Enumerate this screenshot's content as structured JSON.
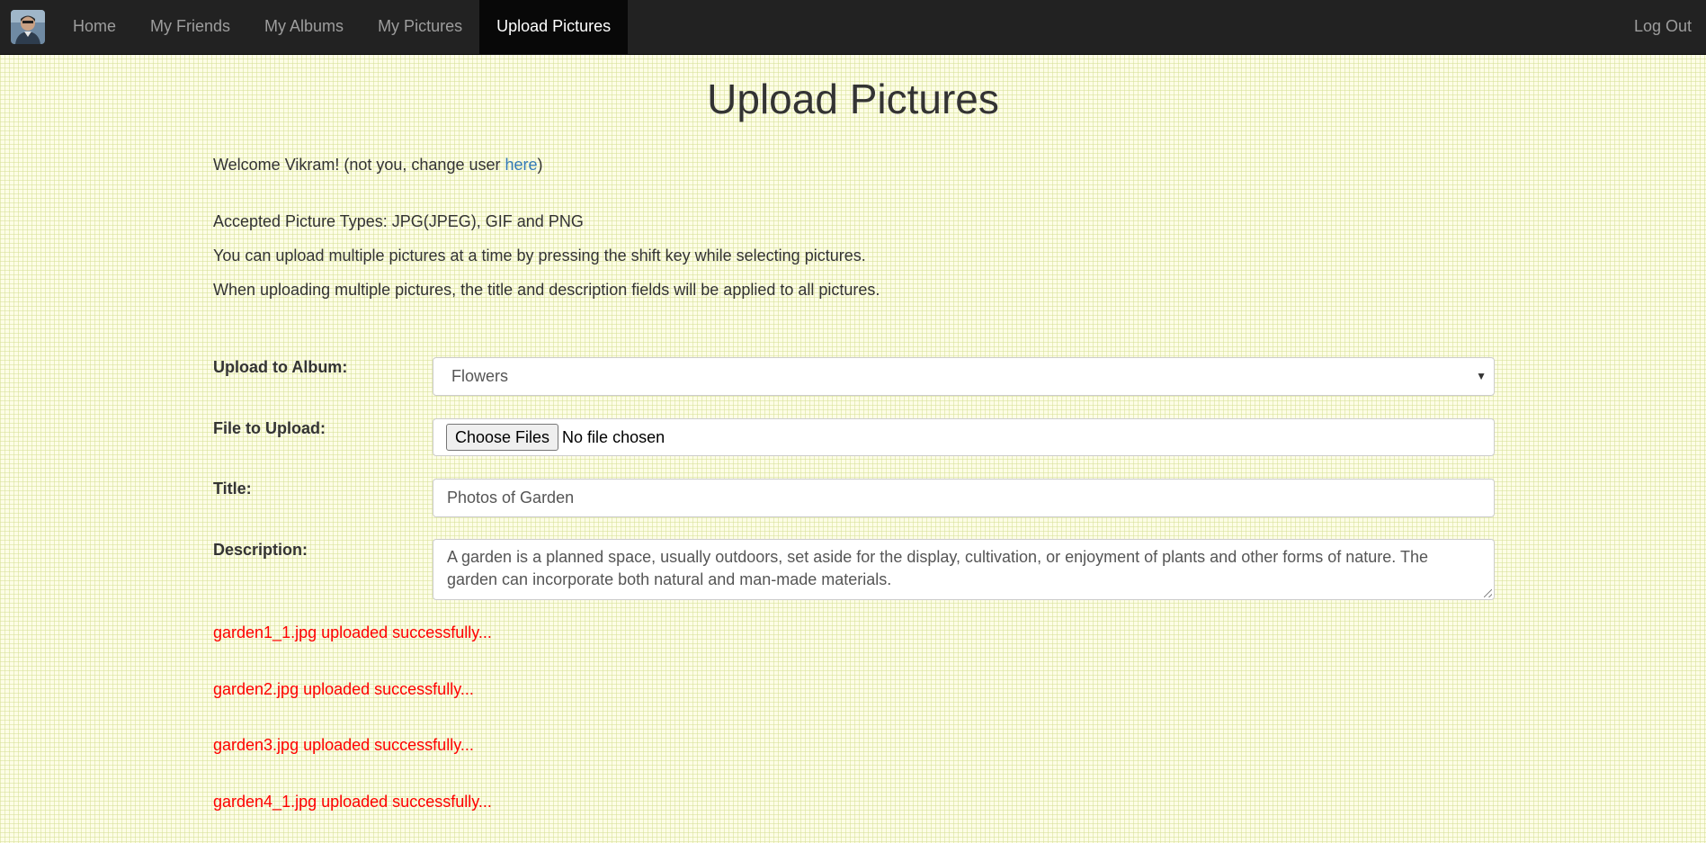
{
  "nav": {
    "items": [
      {
        "label": "Home",
        "active": false
      },
      {
        "label": "My Friends",
        "active": false
      },
      {
        "label": "My Albums",
        "active": false
      },
      {
        "label": "My Pictures",
        "active": false
      },
      {
        "label": "Upload Pictures",
        "active": true
      }
    ],
    "logout_label": "Log Out"
  },
  "page": {
    "title": "Upload Pictures"
  },
  "welcome": {
    "prefix": "Welcome Vikram! (not you, change user ",
    "link_label": "here",
    "suffix": ")"
  },
  "info": {
    "line1": "Accepted Picture Types: JPG(JPEG), GIF and PNG",
    "line2": "You can upload multiple pictures at a time by pressing the shift key while selecting pictures.",
    "line3": "When uploading multiple pictures, the title and description fields will be applied to all pictures."
  },
  "form": {
    "album_label": "Upload to Album:",
    "album_value": "Flowers",
    "file_label": "File to Upload:",
    "file_button": "Choose Files",
    "file_status": "No file chosen",
    "title_label": "Title:",
    "title_value": "Photos of Garden",
    "description_label": "Description:",
    "description_value": "A garden is a planned space, usually outdoors, set aside for the display, cultivation, or enjoyment of plants and other forms of nature. The garden can incorporate both natural and man-made materials."
  },
  "messages": [
    "garden1_1.jpg uploaded successfully...",
    "garden2.jpg uploaded successfully...",
    "garden3.jpg uploaded successfully...",
    "garden4_1.jpg uploaded successfully..."
  ],
  "colors": {
    "navbar": "#222222",
    "active_nav": "#080808",
    "link": "#337ab7",
    "success": "#ff0000",
    "background": "#fdfde6"
  }
}
